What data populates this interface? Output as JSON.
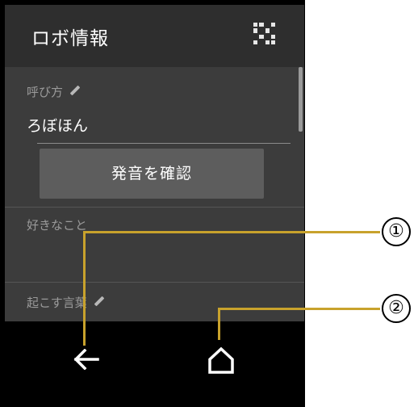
{
  "app_bar": {
    "title": "ロボ情報",
    "qr_icon": "qr-code-icon"
  },
  "fields": {
    "nickname_label": "呼び方",
    "nickname_value": "ろぼほん",
    "confirm_button": "発音を確認",
    "likes_label": "好きなこと",
    "wake_word_label": "起こす言葉"
  },
  "nav": {
    "back_icon": "back-arrow-icon",
    "home_icon": "home-icon"
  },
  "callouts": [
    "①",
    "②"
  ],
  "colors": {
    "screen_bg": "#3c3c3c",
    "appbar_bg": "#2e2e2e",
    "button_bg": "#5d5d5d",
    "callout_line": "#c8a22c"
  }
}
